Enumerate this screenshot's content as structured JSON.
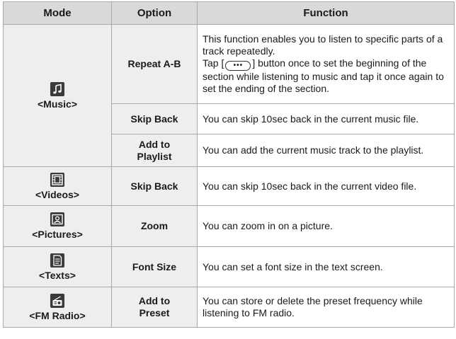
{
  "headers": {
    "mode": "Mode",
    "option": "Option",
    "function": "Function"
  },
  "modes": {
    "music": "<Music>",
    "videos": "<Videos>",
    "pictures": "<Pictures>",
    "texts": "<Texts>",
    "fm_radio": "<FM Radio>"
  },
  "rows": {
    "repeat_ab": {
      "option": "Repeat A-B",
      "fn_1": "This function enables you to listen to specific parts of a track repeatedly.",
      "fn_2a": "Tap [",
      "button_glyph": "•••",
      "fn_2b": "] button once to set the beginning of the section while listening to music and tap it once again to set the ending of the section."
    },
    "skip_back_music": {
      "option": "Skip Back",
      "fn": "You can skip 10sec back in the current music file."
    },
    "add_to_playlist": {
      "option_1": "Add to",
      "option_2": "Playlist",
      "fn": "You can add the current music track to the playlist."
    },
    "skip_back_video": {
      "option": "Skip Back",
      "fn": "You can skip 10sec back in the current video file."
    },
    "zoom": {
      "option": "Zoom",
      "fn": "You can zoom in on a picture."
    },
    "font_size": {
      "option": "Font Size",
      "fn": "You can set a font size in the text screen."
    },
    "add_to_preset": {
      "option_1": "Add to",
      "option_2": "Preset",
      "fn": "You can store or delete the preset frequency while listening to FM radio."
    }
  },
  "icons": {
    "music": "music-note-icon",
    "videos": "film-icon",
    "pictures": "picture-icon",
    "texts": "document-icon",
    "fm_radio": "radio-icon"
  },
  "colors": {
    "header_bg": "#d9d9d9",
    "label_bg": "#eeeeee",
    "border": "#a9a9a9",
    "icon_bg": "#3a3a3a"
  }
}
